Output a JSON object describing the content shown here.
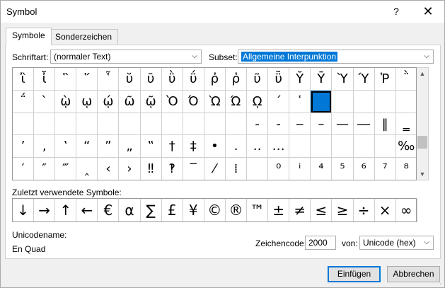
{
  "window": {
    "title": "Symbol",
    "help": "?",
    "close": "✕"
  },
  "tabs": [
    {
      "label": "Symbole",
      "active": true
    },
    {
      "label": "Sonderzeichen",
      "active": false
    }
  ],
  "font": {
    "label": "Schriftart:",
    "value": "(normaler Text)"
  },
  "subset": {
    "label": "Subset:",
    "value": "Allgemeine Interpunktion"
  },
  "symbol_grid": [
    [
      "ἲ",
      "ἶ",
      "῝",
      "῞",
      "῟",
      "ῠ",
      "ῡ",
      "ῢ",
      "ΰ",
      "ῤ",
      "ῥ",
      "ῦ",
      "ῧ",
      "Ῠ",
      "Ῡ",
      "Ὺ",
      "Ύ",
      "Ῥ",
      "῭"
    ],
    [
      "΅",
      "`",
      "ῲ",
      "ῳ",
      "ῴ",
      "ῶ",
      "ῷ",
      "Ὸ",
      "Ό",
      "Ὼ",
      "Ώ",
      "ῼ",
      "´",
      "῾",
      " ",
      " ",
      " ",
      " ",
      " "
    ],
    [
      " ",
      " ",
      " ",
      " ",
      " ",
      " ",
      " ",
      " ",
      " ",
      " ",
      " ",
      "‐",
      "‑",
      "‒",
      "–",
      "—",
      "―",
      "‖",
      "‗",
      "‘"
    ],
    [
      "’",
      "‚",
      "‛",
      "“",
      "”",
      "„",
      "‟",
      "†",
      "‡",
      "•",
      "․",
      "‥",
      "…",
      " ",
      " ",
      " ",
      " ",
      " ",
      "‰"
    ],
    [
      "′",
      "″",
      "‴",
      "‸",
      "‹",
      "›",
      "‼",
      "‽",
      "‾",
      "⁄",
      "⁞",
      " ",
      "⁰",
      "ⁱ",
      "⁴",
      "⁵",
      "⁶",
      "⁷",
      "⁸"
    ]
  ],
  "selected_cell": {
    "row": 1,
    "col": 14
  },
  "recent": {
    "label": "Zuletzt verwendete Symbole:",
    "symbols": [
      "↓",
      "→",
      "↑",
      "←",
      "€",
      "α",
      "∑",
      "£",
      "¥",
      "©",
      "®",
      "™",
      "±",
      "≠",
      "≤",
      "≥",
      "÷",
      "×",
      "∞"
    ]
  },
  "unicode_name": {
    "label": "Unicodename:",
    "value": "En Quad"
  },
  "charcode": {
    "label": "Zeichencode:",
    "value": "2000"
  },
  "from": {
    "label": "von:",
    "value": "Unicode (hex)"
  },
  "buttons": {
    "insert": "Einfügen",
    "cancel": "Abbrechen"
  },
  "icons": {
    "dropdown": "chevron-down-icon",
    "scroll_up": "arrow-up-icon",
    "scroll_down": "arrow-down-icon"
  },
  "colors": {
    "accent": "#0078d7"
  }
}
